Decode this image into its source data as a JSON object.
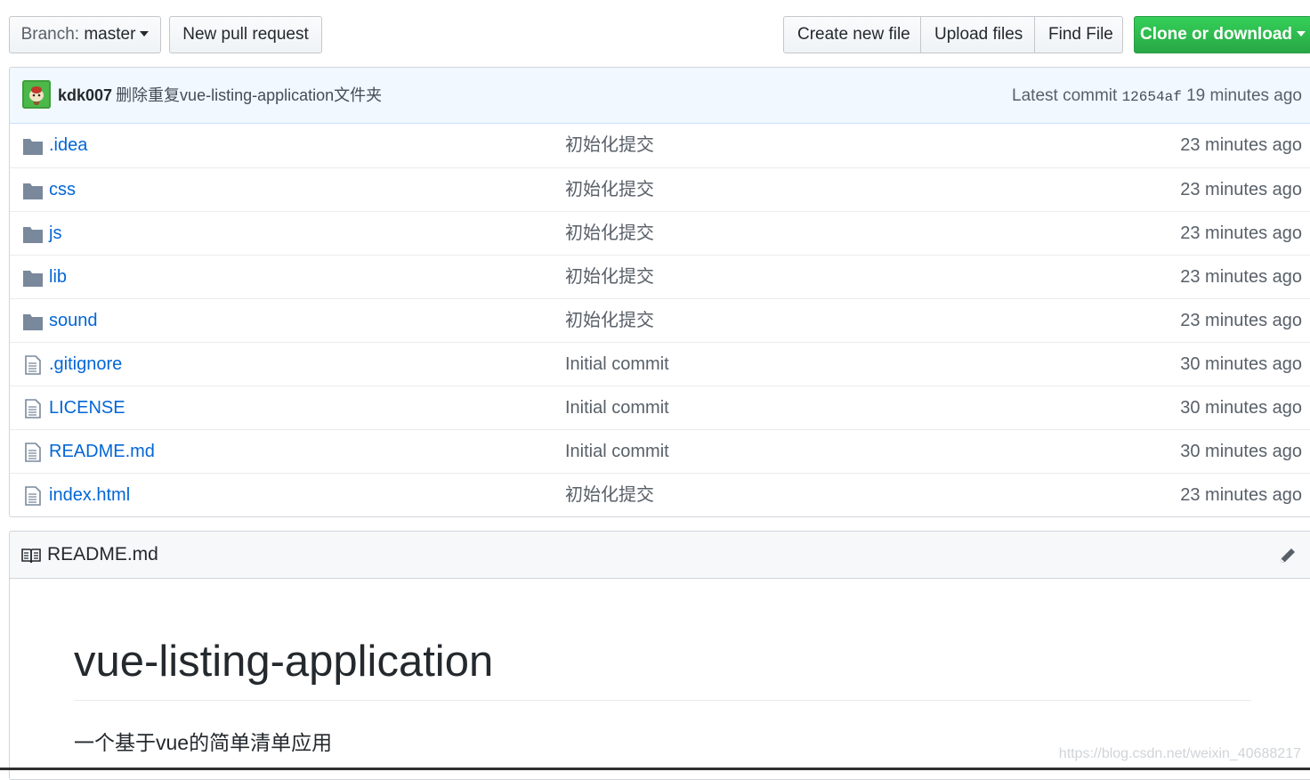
{
  "toolbar": {
    "branch_prefix": "Branch:",
    "branch_name": "master",
    "new_pr": "New pull request",
    "create_file": "Create new file",
    "upload_files": "Upload files",
    "find_file": "Find File",
    "clone_download": "Clone or download"
  },
  "commit": {
    "author": "kdk007",
    "message": "删除重复vue-listing-application文件夹",
    "latest_label": "Latest commit",
    "sha": "12654af",
    "age": "19 minutes ago"
  },
  "files": [
    {
      "type": "folder",
      "name": ".idea",
      "message": "初始化提交",
      "age": "23 minutes ago"
    },
    {
      "type": "folder",
      "name": "css",
      "message": "初始化提交",
      "age": "23 minutes ago"
    },
    {
      "type": "folder",
      "name": "js",
      "message": "初始化提交",
      "age": "23 minutes ago"
    },
    {
      "type": "folder",
      "name": "lib",
      "message": "初始化提交",
      "age": "23 minutes ago"
    },
    {
      "type": "folder",
      "name": "sound",
      "message": "初始化提交",
      "age": "23 minutes ago"
    },
    {
      "type": "file",
      "name": ".gitignore",
      "message": "Initial commit",
      "age": "30 minutes ago"
    },
    {
      "type": "file",
      "name": "LICENSE",
      "message": "Initial commit",
      "age": "30 minutes ago"
    },
    {
      "type": "file",
      "name": "README.md",
      "message": "Initial commit",
      "age": "30 minutes ago"
    },
    {
      "type": "file",
      "name": "index.html",
      "message": "初始化提交",
      "age": "23 minutes ago"
    }
  ],
  "readme": {
    "filename": "README.md",
    "heading": "vue-listing-application",
    "description": "一个基于vue的简单清单应用"
  },
  "watermark": "https://blog.csdn.net/weixin_40688217",
  "colors": {
    "link": "#0366d6",
    "primary_button": "#28a745",
    "commit_bar": "#f1f8ff",
    "icon": "#79889b"
  }
}
